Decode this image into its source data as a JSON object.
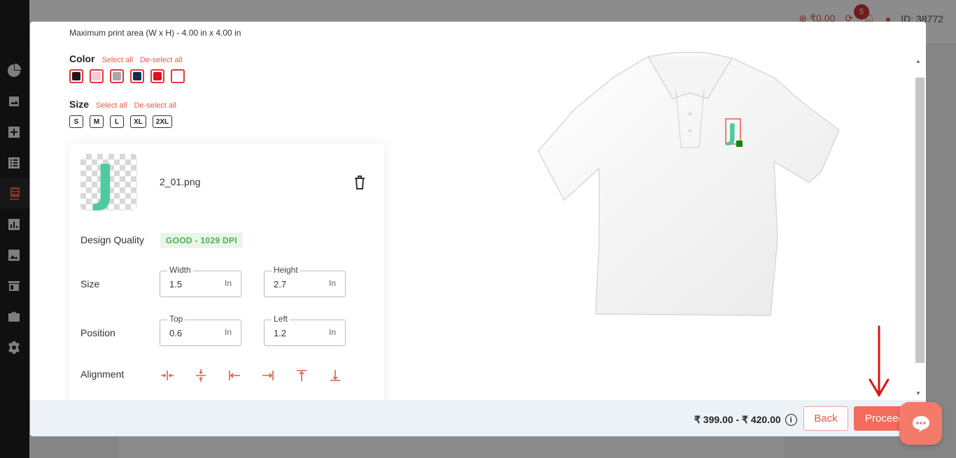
{
  "header": {
    "wallet": "₹0.00",
    "notification_count": "5",
    "user_id": "ID: 38772"
  },
  "modal": {
    "print_area": "Maximum print area (W x H) - 4.00 in x 4.00 in",
    "color": {
      "label": "Color",
      "select_all": "Select all",
      "deselect_all": "De-select all",
      "swatches": [
        "#1a1a1a",
        "#f8c8d4",
        "#a8a8a8",
        "#162d4e",
        "#e0101e",
        "#ffffff"
      ]
    },
    "size": {
      "label": "Size",
      "select_all": "Select all",
      "deselect_all": "De-select all",
      "options": [
        "S",
        "M",
        "L",
        "XL",
        "2XL"
      ]
    },
    "design": {
      "filename": "2_01.png",
      "thumb_letter": "J",
      "quality_label": "Design Quality",
      "quality_value": "GOOD - 1029 DPI",
      "size_label": "Size",
      "width_legend": "Width",
      "width_value": "1.5",
      "height_legend": "Height",
      "height_value": "2.7",
      "position_label": "Position",
      "top_legend": "Top",
      "top_value": "0.6",
      "left_legend": "Left",
      "left_value": "1.2",
      "unit": "In",
      "alignment_label": "Alignment"
    },
    "footer": {
      "price": "₹ 399.00 - ₹ 420.00",
      "back_label": "Back",
      "proceed_label": "Proceed"
    }
  },
  "colors": {
    "accent": "#f26b5b",
    "quality_good": "#4caf50"
  }
}
